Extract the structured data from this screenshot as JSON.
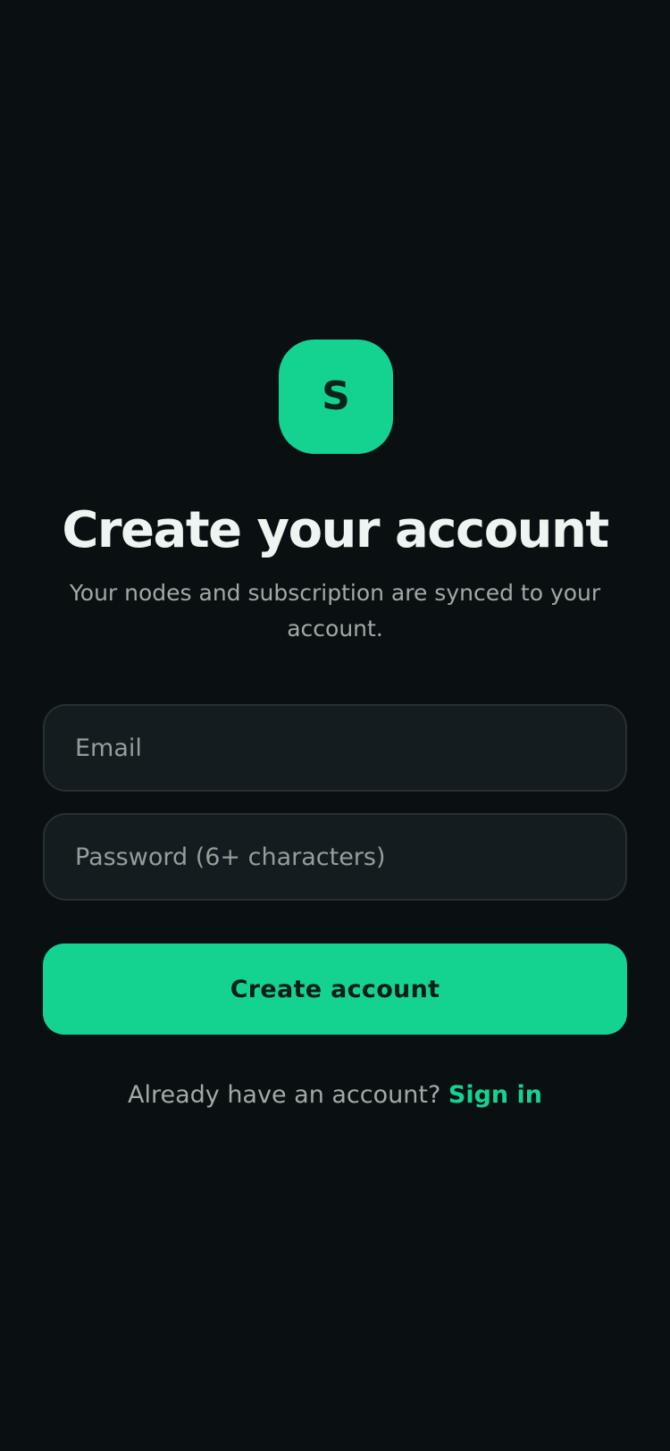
{
  "logo": {
    "letter": "S",
    "color": "#14d391"
  },
  "heading": {
    "title": "Create your account",
    "subtitle": "Your nodes and subscription are synced to your account."
  },
  "form": {
    "email": {
      "value": "",
      "placeholder": "Email"
    },
    "password": {
      "value": "",
      "placeholder": "Password (6+ characters)"
    },
    "submit_label": "Create account"
  },
  "footer": {
    "prompt": "Already have an account?",
    "link_label": "Sign in"
  },
  "colors": {
    "background": "#0a1012",
    "accent": "#14d391",
    "field_background": "#141c1f",
    "field_border": "#263033",
    "muted_text": "#a0aaa7"
  }
}
